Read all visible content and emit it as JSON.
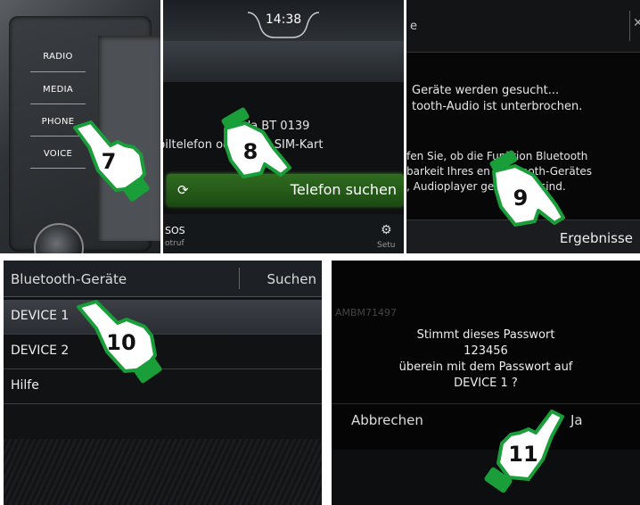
{
  "colors": {
    "accent_green": "#2f6b20",
    "hand_green": "#1a9e3a",
    "hand_white": "#ffffff"
  },
  "steps": [
    "7",
    "8",
    "9",
    "10",
    "11"
  ],
  "panel_hardware": {
    "buttons": [
      "RADIO",
      "MEDIA",
      "PHONE",
      "VOICE"
    ]
  },
  "panel_phone_search": {
    "clock": "14:38",
    "device_line": "oda BT 0139",
    "hint_line": "biltelefon oder eine SIM-Kart",
    "search_button": "Telefon suchen",
    "sos_label": "SOS",
    "notruf_label": "otruf",
    "setup_label": "Setu"
  },
  "panel_searching": {
    "title_fragment": "e",
    "line1": "Geräte werden gesucht...",
    "line2": "tooth-Audio ist unterbrochen.",
    "line3": "fen Sie, ob die Funktion Bluetooth",
    "line4": "barkeit Ihres     en Bluetooth-Gerätes",
    "line5": ", Audioplayer     geschaltet sind.",
    "results_button": "Ergebnisse"
  },
  "panel_devices": {
    "title": "Bluetooth-Geräte",
    "search": "Suchen",
    "items": [
      "DEVICE 1",
      "DEVICE 2",
      "Hilfe"
    ]
  },
  "panel_password": {
    "ghost_text": "AMBM71497",
    "line1": "Stimmt dieses Passwort",
    "line2": "123456",
    "line3": "überein mit dem Passwort auf",
    "line4": "DEVICE 1 ?",
    "cancel": "Abbrechen",
    "confirm": "Ja"
  }
}
